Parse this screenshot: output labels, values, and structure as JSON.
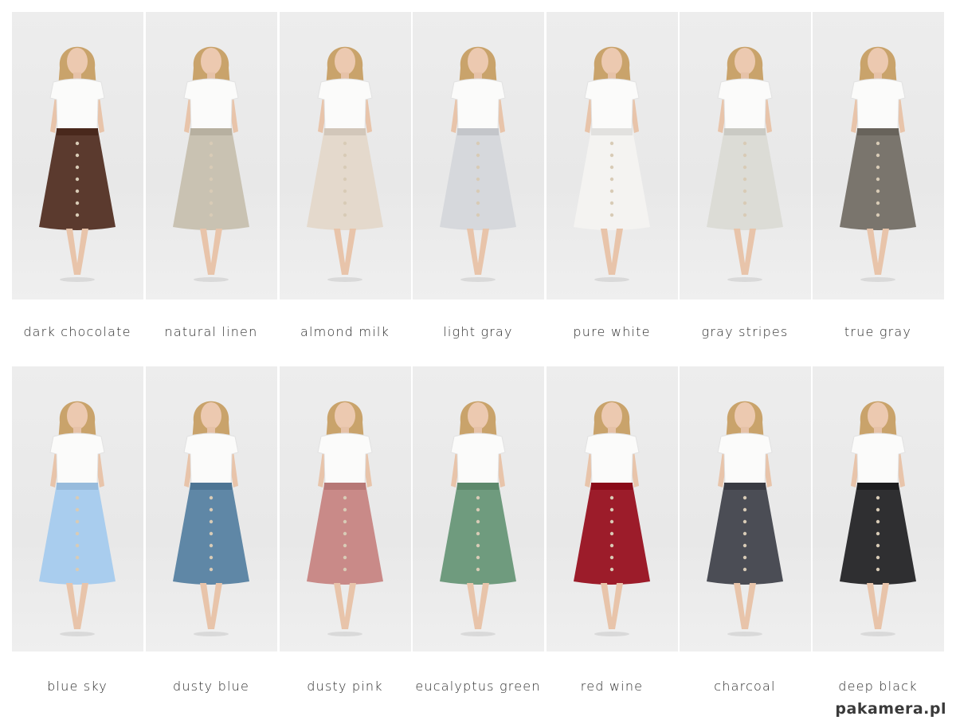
{
  "rows": [
    {
      "items": [
        {
          "label": "dark chocolate",
          "skirt_color": "#5b3a2e"
        },
        {
          "label": "natural linen",
          "skirt_color": "#c9c2b2"
        },
        {
          "label": "almond milk",
          "skirt_color": "#e4d9cc"
        },
        {
          "label": "light gray",
          "skirt_color": "#d6d8dc"
        },
        {
          "label": "pure white",
          "skirt_color": "#f4f3f1"
        },
        {
          "label": "gray stripes",
          "skirt_color": "#dcdcd6"
        },
        {
          "label": "true gray",
          "skirt_color": "#7a756d"
        }
      ]
    },
    {
      "items": [
        {
          "label": "blue sky",
          "skirt_color": "#a9cdee"
        },
        {
          "label": "dusty blue",
          "skirt_color": "#5f87a6"
        },
        {
          "label": "dusty pink",
          "skirt_color": "#c98a88"
        },
        {
          "label": "eucalyptus green",
          "skirt_color": "#6f9b7e"
        },
        {
          "label": "red wine",
          "skirt_color": "#9c1c2a"
        },
        {
          "label": "charcoal",
          "skirt_color": "#4b4d55"
        },
        {
          "label": "deep black",
          "skirt_color": "#2f2f31"
        }
      ]
    }
  ],
  "watermark": "pakamera.pl"
}
